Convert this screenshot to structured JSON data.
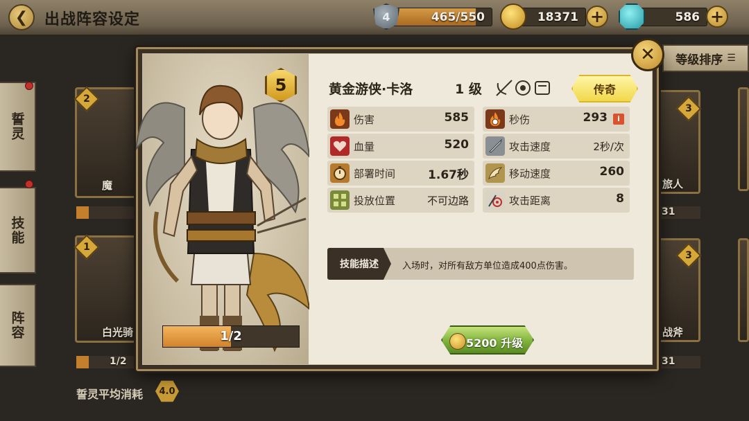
{
  "header": {
    "title": "出战阵容设定",
    "back_icon": "back-arrow-icon",
    "stamina": {
      "value": "465/550",
      "level": "4",
      "fill_fraction": 0.845
    },
    "gold": "18371",
    "gems": "586"
  },
  "sidebar": {
    "tabs": [
      {
        "label": "誓灵"
      },
      {
        "label": "技能"
      },
      {
        "label": "阵容"
      }
    ]
  },
  "background": {
    "sort_label": "等级排序",
    "cards": [
      {
        "name": "魔",
        "level": "2"
      },
      {
        "name": "白光骑",
        "level": "1",
        "progress": "1/2"
      },
      {
        "name": "旅人",
        "level": "3",
        "progress": "31"
      },
      {
        "name": "战斧",
        "level": "3",
        "progress": "31"
      }
    ],
    "avg_cost_label": "誓灵平均消耗",
    "avg_cost_value": "4.0"
  },
  "hero": {
    "star_level": "5",
    "name": "黄金游侠·卡洛",
    "level_text": "1 级",
    "rarity": "传奇",
    "shards": "1/2",
    "shard_fraction": 0.5,
    "stats": [
      {
        "icon": "fire-icon",
        "label": "伤害",
        "value": "585"
      },
      {
        "icon": "fire-clock-icon",
        "label": "秒伤",
        "value": "293"
      },
      {
        "icon": "heart-icon",
        "label": "血量",
        "value": "520"
      },
      {
        "icon": "sword-speed-icon",
        "label": "攻击速度",
        "value": "2秒/次"
      },
      {
        "icon": "stopwatch-icon",
        "label": "部署时间",
        "value": "1.67秒"
      },
      {
        "icon": "wing-icon",
        "label": "移动速度",
        "value": "260"
      },
      {
        "icon": "placement-icon",
        "label": "投放位置",
        "value": "不可边路"
      },
      {
        "icon": "target-icon",
        "label": "攻击距离",
        "value": "8"
      }
    ],
    "skill": {
      "tag": "技能描述",
      "desc": "入场时，对所有敌方单位造成400点伤害。"
    },
    "upgrade": {
      "cost": "5200",
      "label": "升级"
    }
  }
}
